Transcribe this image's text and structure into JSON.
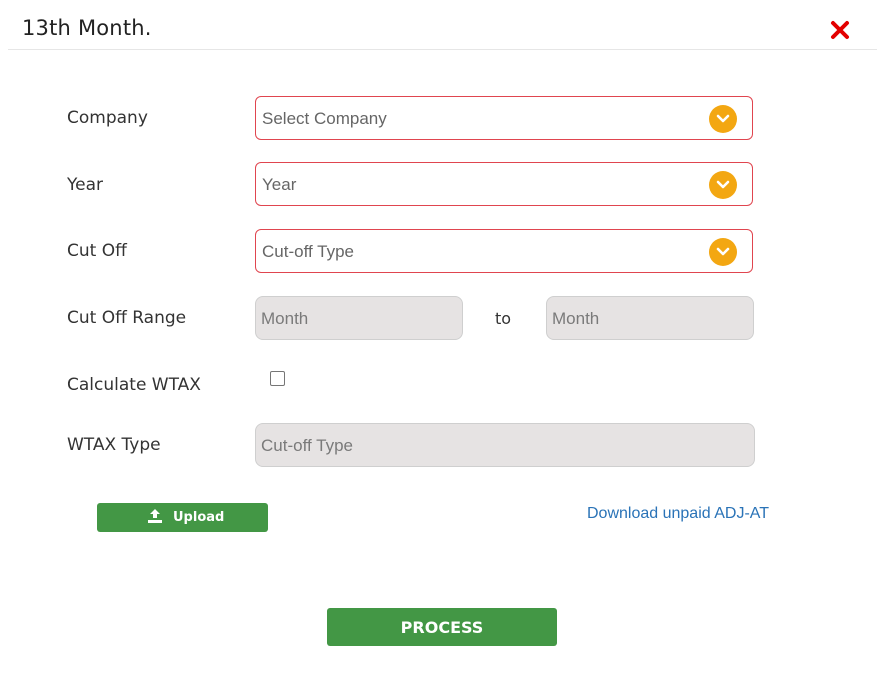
{
  "dialog": {
    "title": "13th Month.",
    "close_icon": "close-x-icon",
    "close_color": "#e30000"
  },
  "form": {
    "company": {
      "label": "Company",
      "placeholder": "Select Company"
    },
    "year": {
      "label": "Year",
      "placeholder": "Year"
    },
    "cut_off": {
      "label": "Cut Off",
      "placeholder": "Cut-off Type"
    },
    "cut_off_range": {
      "label": "Cut Off Range",
      "from_placeholder": "Month",
      "separator": "to",
      "to_placeholder": "Month"
    },
    "calculate_wtax": {
      "label": "Calculate WTAX",
      "checked": false
    },
    "wtax_type": {
      "label": "WTAX Type",
      "placeholder": "Cut-off Type"
    }
  },
  "actions": {
    "upload_label": "Upload",
    "upload_icon": "upload-icon",
    "download_link": "Download unpaid ADJ-AT",
    "process_label": "PROCESS"
  },
  "colors": {
    "accent_green": "#439745",
    "select_border": "#e0454f",
    "chevron": "#f3a712",
    "link": "#2a73b7"
  }
}
